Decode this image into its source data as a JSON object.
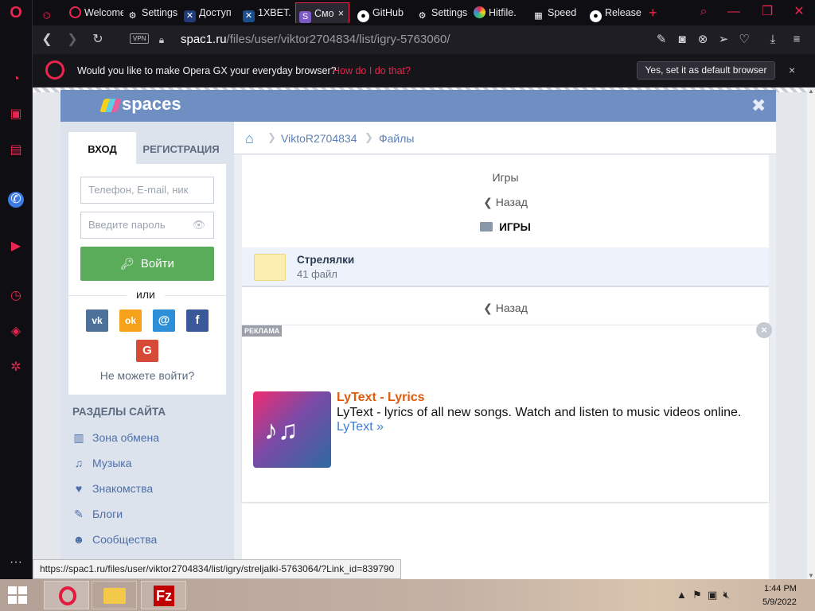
{
  "browser": {
    "tabs": [
      {
        "label": "",
        "icon": "gamepad-icon"
      },
      {
        "label": "Welcome",
        "icon": "opera-icon"
      },
      {
        "label": "Settings",
        "icon": "gear-icon"
      },
      {
        "label": "Доступ",
        "icon": "site-icon"
      },
      {
        "label": "1XBET.",
        "icon": "site-icon"
      },
      {
        "label": "Смо",
        "icon": "spaces-icon",
        "active": true
      },
      {
        "label": "GitHub",
        "icon": "github-icon"
      },
      {
        "label": "Settings",
        "icon": "gear-icon"
      },
      {
        "label": "Hitfile.",
        "icon": "hitfile-icon"
      },
      {
        "label": "Speed",
        "icon": "speed-dial-icon"
      },
      {
        "label": "Release",
        "icon": "github-icon"
      }
    ],
    "new_tab": "+",
    "address": {
      "vpn": "VPN",
      "domain": "spac1.ru",
      "path": "/files/user/viktor2704834/list/igry-5763060/"
    },
    "default_prompt": {
      "text": "Would you like to make Opera GX your everyday browser?",
      "link": "How do I do that?",
      "button": "Yes, set it as default browser",
      "close": "×"
    },
    "status_url": "https://spac1.ru/files/user/viktor2704834/list/igry/streljalki-5763064/?Link_id=839790"
  },
  "site": {
    "logo": "spaces",
    "close": "✖",
    "login": {
      "tab_login": "ВХОД",
      "tab_register": "РЕГИСТРАЦИЯ",
      "login_placeholder": "Телефон, E-mail, ник",
      "password_placeholder": "Введите пароль",
      "submit": "Войти",
      "or": "или",
      "social": [
        "vk",
        "ok",
        "@",
        "f",
        "G"
      ],
      "cant_login": "Не можете войти?"
    },
    "sections": {
      "title": "РАЗДЕЛЫ САЙТА",
      "items": [
        {
          "label": "Зона обмена",
          "icon": "exchange-icon"
        },
        {
          "label": "Музыка",
          "icon": "music-icon"
        },
        {
          "label": "Знакомства",
          "icon": "heart-icon"
        },
        {
          "label": "Блоги",
          "icon": "pencil-icon"
        },
        {
          "label": "Сообщества",
          "icon": "group-icon"
        }
      ]
    },
    "breadcrumb": [
      "ViktoR2704834",
      "Файлы"
    ],
    "folder_caption": "Игры",
    "back": "Назад",
    "section_title": "ИГРЫ",
    "folder": {
      "name": "Стрелялки",
      "count": "41 файл"
    },
    "ad": {
      "badge": "РЕКЛАМА",
      "title": "LyText - Lyrics",
      "description": "LyText - lyrics of all new songs. Watch and listen to music videos online.",
      "link": "LyText »"
    }
  },
  "taskbar": {
    "time": "1:44 PM",
    "date": "5/9/2022",
    "filezilla": "Fz"
  },
  "colors": {
    "opera_accent": "#e8264f",
    "site_header": "#6f8ec1",
    "login_button": "#5aac5a",
    "ad_title": "#e05a0c"
  }
}
